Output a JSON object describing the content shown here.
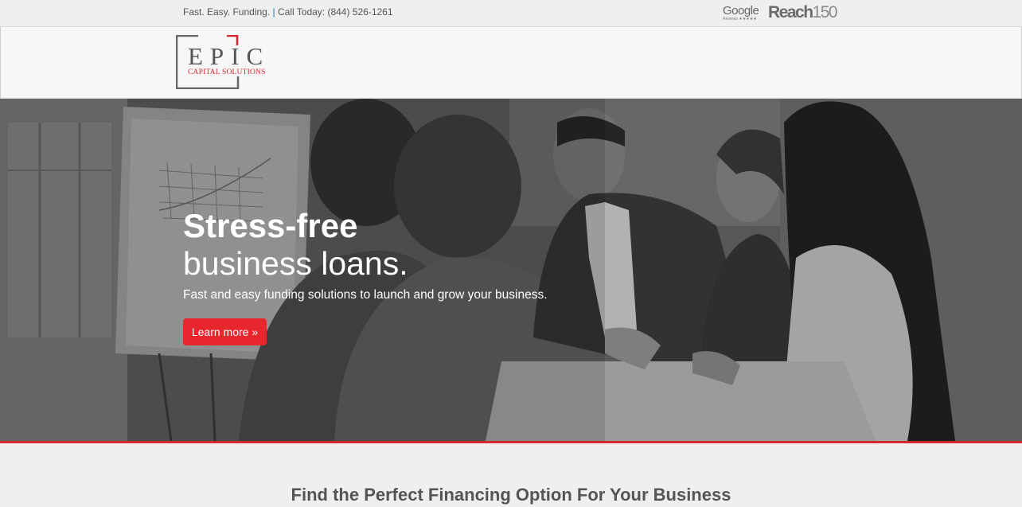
{
  "topbar": {
    "tagline": "Fast. Easy. Funding.",
    "separator": "|",
    "call": "Call Today: (844) 526-1261",
    "google_word": "Google",
    "google_sub": "Reviews ★★★★★",
    "reach_word": "Reach",
    "reach_num": "150"
  },
  "logo": {
    "main": "EPIC",
    "sub": "CAPITAL SOLUTIONS",
    "accent_color": "#d8262f"
  },
  "hero": {
    "title": "Stress-free",
    "subtitle": "business loans.",
    "lead": "Fast and easy funding solutions to launch and grow your business.",
    "cta_label": "Learn more »"
  },
  "section": {
    "title": "Find the Perfect Financing Option For Your Business"
  },
  "colors": {
    "accent": "#e8262e",
    "text_gray": "#555555",
    "page_bg": "#efefef"
  }
}
